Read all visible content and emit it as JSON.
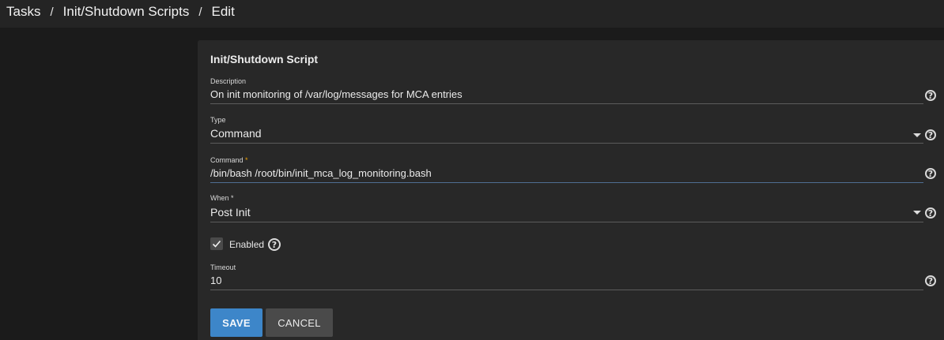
{
  "breadcrumb": {
    "items": [
      "Tasks",
      "Init/Shutdown Scripts",
      "Edit"
    ],
    "separator": "/"
  },
  "form": {
    "title": "Init/Shutdown Script",
    "description": {
      "label": "Description",
      "value": "On init monitoring of /var/log/messages for MCA entries"
    },
    "type": {
      "label": "Type",
      "value": "Command"
    },
    "command": {
      "label": "Command",
      "required_mark": "*",
      "value": "/bin/bash /root/bin/init_mca_log_monitoring.bash"
    },
    "when": {
      "label": "When",
      "required_mark": "*",
      "value": "Post Init"
    },
    "enabled": {
      "label": "Enabled",
      "checked": true
    },
    "timeout": {
      "label": "Timeout",
      "value": "10"
    },
    "buttons": {
      "save": "SAVE",
      "cancel": "CANCEL"
    }
  },
  "colors": {
    "accent": "#3d86c9",
    "required": "#f0a000",
    "background": "#1b1b1b",
    "card": "#282828"
  },
  "icons": [
    "help-icon",
    "chevron-down-icon",
    "checkmark-icon"
  ]
}
